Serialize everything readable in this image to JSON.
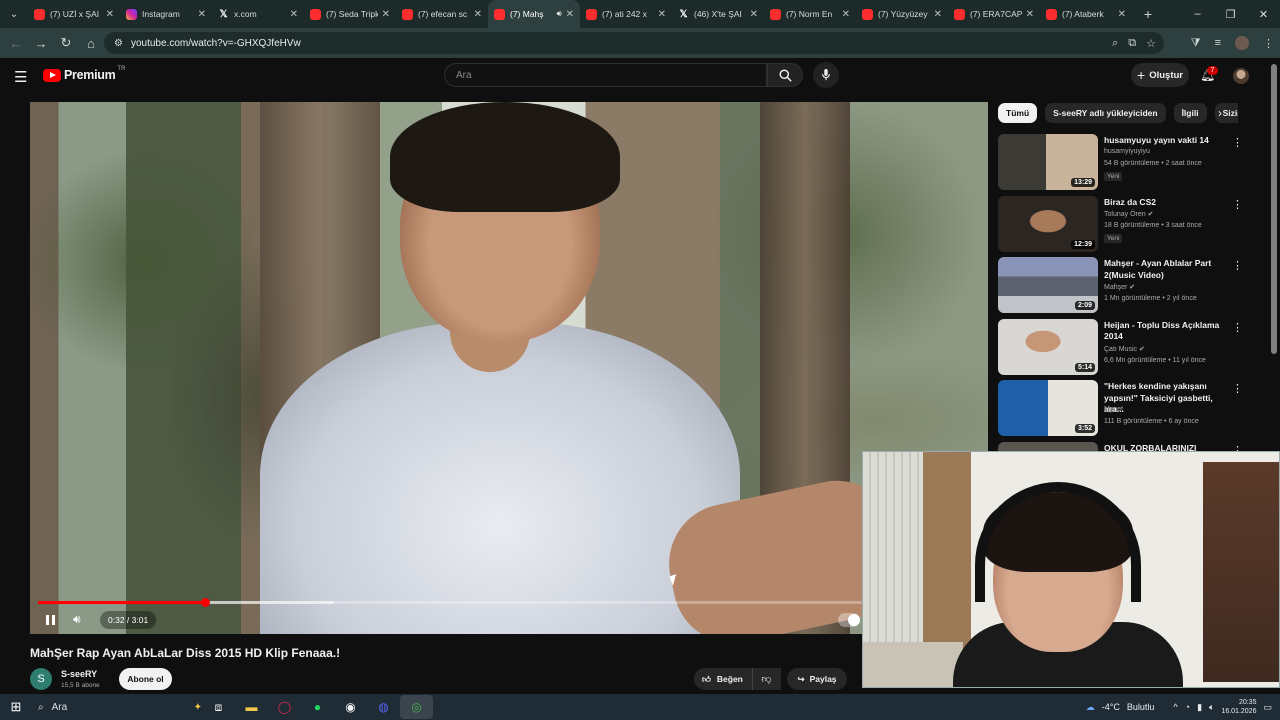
{
  "browser": {
    "tabs": [
      {
        "label": "(7) UZİ x ŞAI",
        "icon": "youtube-favicon"
      },
      {
        "label": "Instagram",
        "icon": "instagram-favicon"
      },
      {
        "label": "x.com",
        "icon": "x-favicon"
      },
      {
        "label": "(7) Seda Tripk",
        "icon": "youtube-favicon"
      },
      {
        "label": "(7) efecan sc",
        "icon": "youtube-favicon"
      },
      {
        "label": "(7) Mahş",
        "icon": "youtube-favicon",
        "active": true
      },
      {
        "label": "(7) ati 242 x",
        "icon": "youtube-favicon"
      },
      {
        "label": "(46) X'te ŞAI",
        "icon": "x-favicon"
      },
      {
        "label": "(7) Norm En",
        "icon": "youtube-favicon"
      },
      {
        "label": "(7) Yüzyüzey",
        "icon": "youtube-favicon"
      },
      {
        "label": "(7) ERA7CAP",
        "icon": "youtube-favicon"
      },
      {
        "label": "(7) Ataberk",
        "icon": "youtube-favicon"
      }
    ],
    "url": "youtube.com/watch?v=-GHXQJfeHVw"
  },
  "youtube": {
    "logo_text": "Premium",
    "logo_country": "TR",
    "search_placeholder": "Ara",
    "create_label": "Oluştur",
    "notification_count": "7"
  },
  "player": {
    "current_time": "0:32",
    "duration": "3:01",
    "time_display": "0:32 / 3:01",
    "progress_fraction": 0.177,
    "state": "playing"
  },
  "video": {
    "title": "MahŞer Rap Ayan AbLaLar Diss 2015 HD Klip Fenaaa.!",
    "channel_name": "S-seeRY",
    "channel_initial": "S",
    "subscribers": "15,5 B abone",
    "subscribe_label": "Abone ol",
    "like_label": "Beğen",
    "share_label": "Paylaş"
  },
  "sidebar": {
    "chips": [
      "Tümü",
      "S-seeRY adlı yükleyiciden",
      "İlgili",
      "Sizin"
    ],
    "recommendations": [
      {
        "title": "husamyuyu yayın vakti 14",
        "channel": "husamyiyuyiyu",
        "meta": "54 B görüntüleme • 2 saat önce",
        "badge": "Yeni",
        "duration": "13:29",
        "verified": false
      },
      {
        "title": "Biraz da CS2",
        "channel": "Tolunay Ören",
        "meta": "18 B görüntüleme • 3 saat önce",
        "badge": "Yeni",
        "duration": "12:39",
        "verified": true
      },
      {
        "title": "Mahşer - Ayan Ablalar Part 2(Music Video)",
        "channel": "Mahşer",
        "meta": "1 Mn görüntüleme • 2 yıl önce",
        "badge": "",
        "duration": "2:09",
        "verified": true
      },
      {
        "title": "Heijan - Toplu Diss Açıklama 2014",
        "channel": "Çatı Music",
        "meta": "6,6 Mn görüntüleme • 11 yıl önce",
        "badge": "",
        "duration": "5:14",
        "verified": true
      },
      {
        "title": "\"Herkes kendine yakışanı yapsın!\" Taksiciyi gasbetti, ara...",
        "channel": "Mynet",
        "meta": "111 B görüntüleme • 6 ay önce",
        "badge": "",
        "duration": "3:52",
        "verified": false
      },
      {
        "title": "OKUL ZORBALARINIZI ARADIM!",
        "channel": "",
        "meta": "",
        "badge": "",
        "duration": "",
        "verified": false
      }
    ]
  },
  "taskbar": {
    "search_label": "Ara",
    "weather_temp": "-4°C",
    "weather_desc": "Bulutlu",
    "time": "20:35",
    "date": "16.01.2026"
  }
}
